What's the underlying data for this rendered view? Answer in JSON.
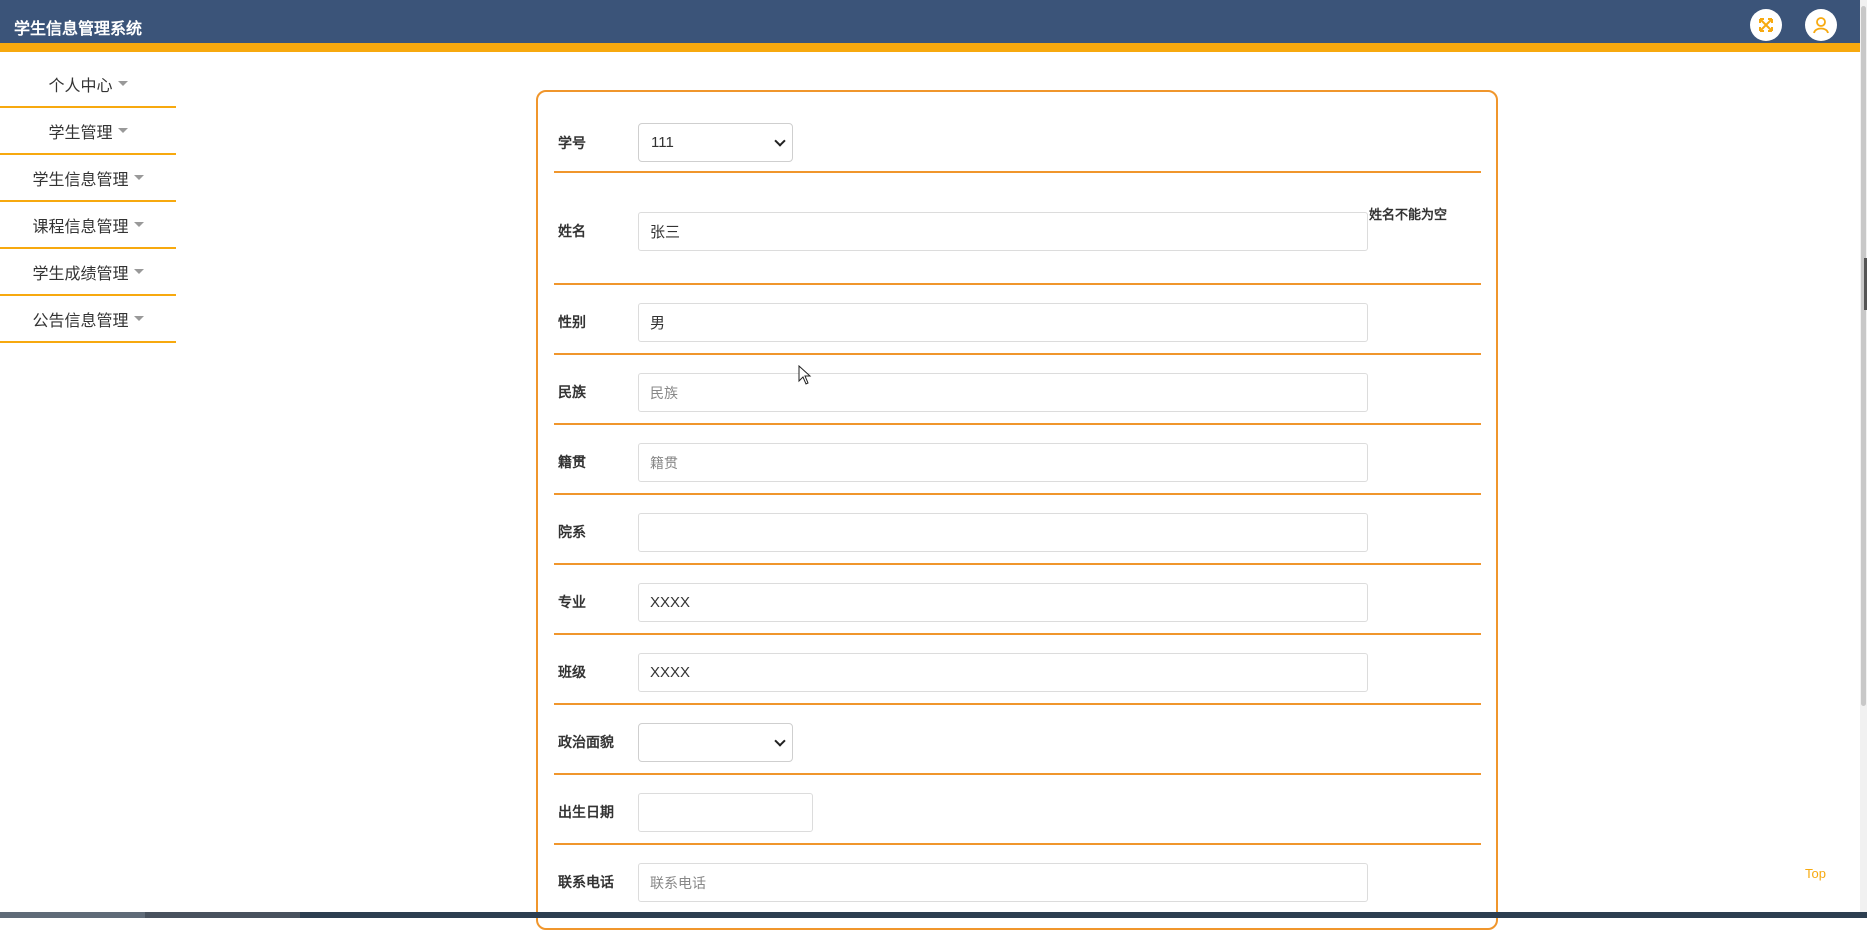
{
  "header": {
    "title": "学生信息管理系统",
    "fullscreen_icon": "expand-arrows-icon",
    "user_icon": "user-icon"
  },
  "colors": {
    "header_bg": "#3b5479",
    "accent": "#f7a90f",
    "border": "#f0962c"
  },
  "sidebar": {
    "items": [
      {
        "label": "个人中心"
      },
      {
        "label": "学生管理"
      },
      {
        "label": "学生信息管理"
      },
      {
        "label": "课程信息管理"
      },
      {
        "label": "学生成绩管理"
      },
      {
        "label": "公告信息管理"
      }
    ]
  },
  "form": {
    "student_id": {
      "label": "学号",
      "value": "111"
    },
    "name": {
      "label": "姓名",
      "value": "张三",
      "error": "姓名不能为空"
    },
    "gender": {
      "label": "性别",
      "value": "男"
    },
    "ethnicity": {
      "label": "民族",
      "placeholder": "民族"
    },
    "hometown": {
      "label": "籍贯",
      "placeholder": "籍贯"
    },
    "department": {
      "label": "院系",
      "value": ""
    },
    "major": {
      "label": "专业",
      "value": "XXXX"
    },
    "class": {
      "label": "班级",
      "value": "XXXX"
    },
    "political": {
      "label": "政治面貌",
      "value": ""
    },
    "birth_date": {
      "label": "出生日期",
      "value": ""
    },
    "phone": {
      "label": "联系电话",
      "placeholder": "联系电话"
    }
  },
  "back_to_top": "Top"
}
